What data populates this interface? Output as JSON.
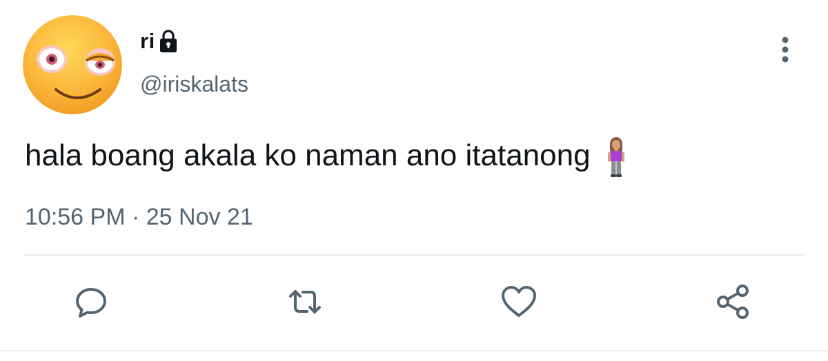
{
  "tweet": {
    "display_name": "ri",
    "handle": "@iriskalats",
    "text": "hala boang akala ko naman ano itatanong",
    "timestamp": "10:56 PM · 25 Nov 21",
    "protected": true
  },
  "icons": {
    "avatar": "flushed-face-emoji",
    "lock": "lock-icon",
    "more": "more-vertical-icon",
    "text_emoji": "woman-standing-emoji",
    "reply": "reply-icon",
    "retweet": "retweet-icon",
    "like": "heart-icon",
    "share": "share-icon"
  },
  "colors": {
    "text_primary": "#0f1419",
    "text_secondary": "#536471",
    "icon": "#536471",
    "divider": "#e6ecf0"
  }
}
